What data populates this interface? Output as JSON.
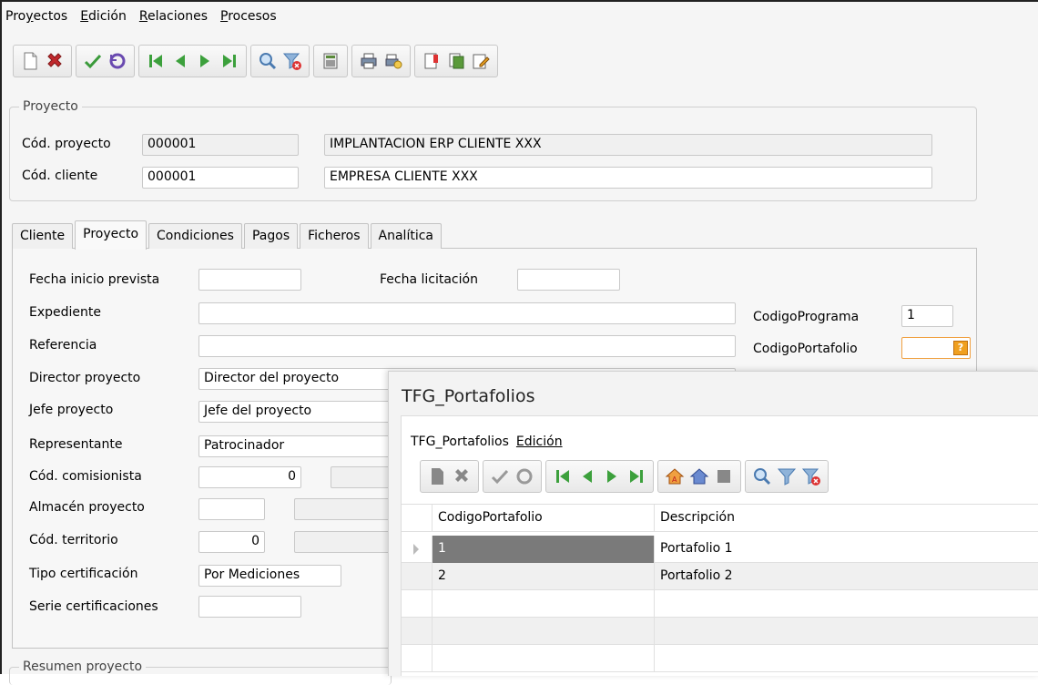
{
  "menu": {
    "items": [
      "Proyectos",
      "Edición",
      "Relaciones",
      "Procesos"
    ]
  },
  "toolbar": {
    "groups": [
      [
        "new-doc-icon",
        "delete-icon"
      ],
      [
        "confirm-icon",
        "undo-icon"
      ],
      [
        "first-icon",
        "prev-icon",
        "next-icon",
        "last-icon"
      ],
      [
        "search-icon",
        "filter-clear-icon"
      ],
      [
        "calculator-icon"
      ],
      [
        "print-icon",
        "print-preview-icon"
      ],
      [
        "report-icon",
        "copy-icon",
        "edit-icon"
      ]
    ]
  },
  "proyecto": {
    "title": "Proyecto",
    "cod_proyecto_label": "Cód. proyecto",
    "cod_proyecto_value": "000001",
    "nombre_proyecto": "IMPLANTACION ERP CLIENTE XXX",
    "cod_cliente_label": "Cód. cliente",
    "cod_cliente_value": "000001",
    "nombre_cliente": "EMPRESA CLIENTE XXX"
  },
  "tabs": [
    "Cliente",
    "Proyecto",
    "Condiciones",
    "Pagos",
    "Ficheros",
    "Analítica"
  ],
  "active_tab": "Proyecto",
  "form": {
    "fecha_inicio_label": "Fecha inicio prevista",
    "fecha_licitacion_label": "Fecha licitación",
    "expediente_label": "Expediente",
    "codigo_programa_label": "CodigoPrograma",
    "codigo_programa_value": "1",
    "referencia_label": "Referencia",
    "codigo_portafolio_label": "CodigoPortafolio",
    "director_label": "Director proyecto",
    "director_value": "Director del proyecto",
    "jefe_label": "Jefe proyecto",
    "jefe_value": "Jefe del proyecto",
    "representante_label": "Representante",
    "representante_value": "Patrocinador",
    "comisionista_label": "Cód. comisionista",
    "comisionista_value": "0",
    "almacen_label": "Almacén proyecto",
    "territorio_label": "Cód. territorio",
    "territorio_value": "0",
    "tipo_cert_label": "Tipo certificación",
    "tipo_cert_value": "Por Mediciones",
    "serie_cert_label": "Serie certificaciones",
    "help_glyph": "?"
  },
  "resumen": {
    "title": "Resumen proyecto"
  },
  "popup": {
    "title": "TFG_Portafolios",
    "menu": [
      "TFG_Portafolios",
      "Edición"
    ],
    "columns": [
      "CodigoPortafolio",
      "Descripción"
    ],
    "rows": [
      {
        "codigo": "1",
        "descripcion": "Portafolio 1"
      },
      {
        "codigo": "2",
        "descripcion": "Portafolio 2"
      }
    ]
  }
}
